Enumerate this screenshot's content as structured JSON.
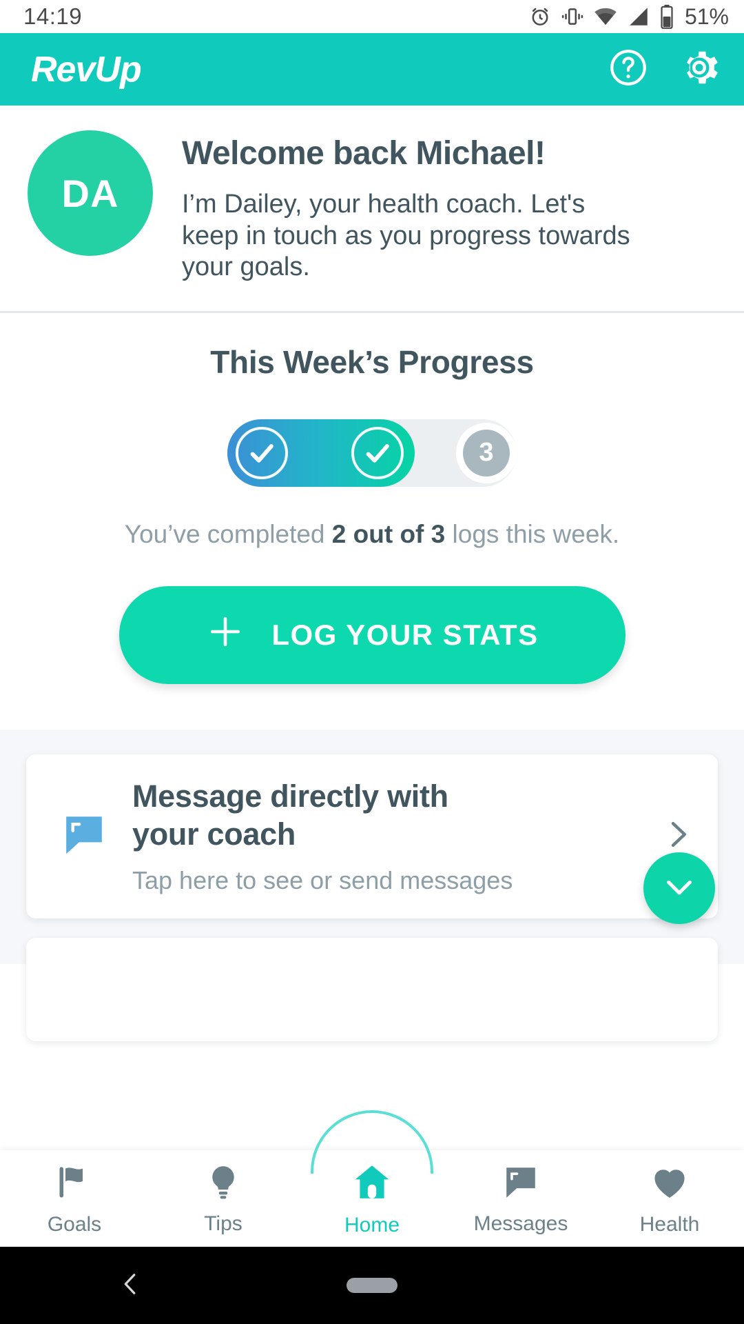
{
  "status_bar": {
    "time": "14:19",
    "battery_percent": "51%",
    "icons": [
      "alarm-icon",
      "vibrate-icon",
      "wifi-icon",
      "cell-signal-icon",
      "battery-icon"
    ]
  },
  "app_bar": {
    "logo": "RevUp",
    "brand_color": "#10cabb",
    "actions": [
      {
        "name": "help-icon",
        "label": "Help"
      },
      {
        "name": "gear-icon",
        "label": "Settings"
      }
    ]
  },
  "welcome": {
    "avatar_initials": "DA",
    "avatar_color": "#23d1a5",
    "title": "Welcome back Michael!",
    "subtitle": "I’m Dailey, your health coach. Let's keep in touch as you progress towards your goals."
  },
  "progress": {
    "title": "This Week’s Progress",
    "completed": 2,
    "total": 3,
    "remaining_label": "3",
    "note_prefix": "You’ve completed ",
    "note_strong": "2 out of 3",
    "note_suffix": " logs this week.",
    "fill_start_color": "#3c8fd6",
    "fill_end_color": "#06d4a4",
    "track_color": "#eceff1",
    "pending_color": "#a9b7bf"
  },
  "cta": {
    "label": "LOG YOUR STATS",
    "icon": "plus-icon",
    "color": "#0ed8ad"
  },
  "message_card": {
    "icon": "speech-bubble-icon",
    "icon_color": "#5aaee0",
    "title": "Message directly with your coach",
    "subtitle": "Tap here to see or send messages",
    "chevron": "chevron-right-icon"
  },
  "fab": {
    "icon": "chevron-down-icon",
    "color": "#0ed4aa"
  },
  "bottom_nav": {
    "active": "Home",
    "items": [
      {
        "label": "Goals",
        "icon": "flag-icon"
      },
      {
        "label": "Tips",
        "icon": "lightbulb-icon"
      },
      {
        "label": "Home",
        "icon": "home-icon"
      },
      {
        "label": "Messages",
        "icon": "speech-bubble-icon"
      },
      {
        "label": "Health",
        "icon": "heart-icon"
      }
    ]
  },
  "system_nav": {
    "back": "back-icon",
    "home": "home-pill"
  }
}
